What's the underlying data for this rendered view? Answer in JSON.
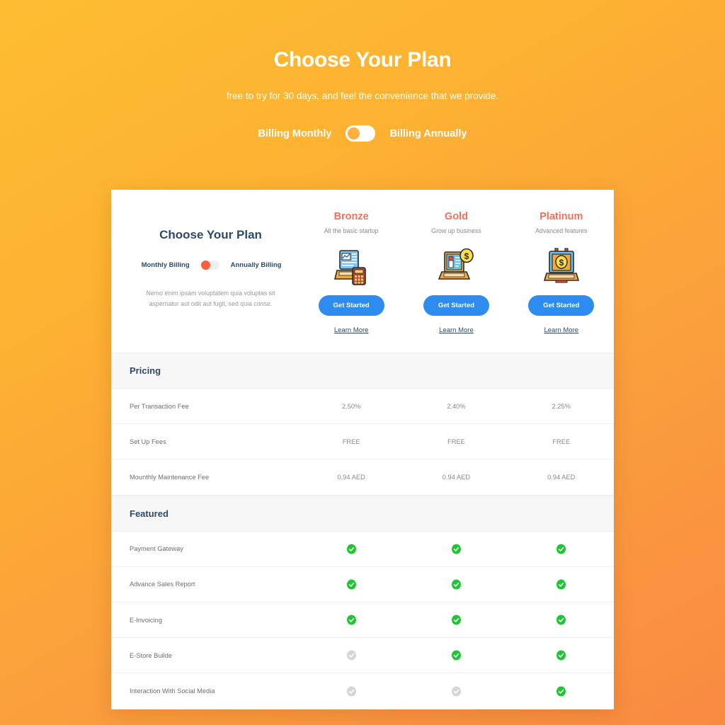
{
  "hero": {
    "title": "Choose Your Plan",
    "subtitle": "free to try for 30 days, and feel the convenience that we provide.",
    "billing_monthly_label": "Billing Monthly",
    "billing_annually_label": "Billing Annually",
    "toggle_state": "monthly"
  },
  "card": {
    "intro": {
      "title": "Choose Your Plan",
      "monthly_label": "Monthly Billing",
      "annually_label": "Annually Billing",
      "toggle_state": "monthly",
      "description_line1": "Nemo enim ipsam voluptatem quia voluptas sit",
      "description_line2": "aspernatur aut odit aut fugit, sed quia conse."
    },
    "plans": [
      {
        "name": "Bronze",
        "subtitle": "All the basic  startup",
        "art": "chart-document-calculator-icon",
        "cta_label": "Get Started",
        "link_label": "Learn More"
      },
      {
        "name": "Gold",
        "subtitle": "Grow up  business",
        "art": "laptop-coin-icon",
        "cta_label": "Get Started",
        "link_label": "Learn More"
      },
      {
        "name": "Platinum",
        "subtitle": "Advanced features",
        "art": "clipboard-dollar-coin-icon",
        "cta_label": "Get Started",
        "link_label": "Learn More"
      }
    ],
    "sections": [
      {
        "title": "Pricing",
        "rows": [
          {
            "label": "Per Transaction Fee",
            "values": [
              "2.50%",
              "2.40%",
              "2.25%"
            ],
            "type": "text"
          },
          {
            "label": "Set Up Fees",
            "values": [
              "FREE",
              "FREE",
              "FREE"
            ],
            "type": "text"
          },
          {
            "label": "Mounthly Maintenance Fee",
            "values": [
              "0.94 AED",
              "0.94 AED",
              "0.94 AED"
            ],
            "type": "text"
          }
        ]
      },
      {
        "title": "Featured",
        "rows": [
          {
            "label": "Payment Gateway",
            "values": [
              "on",
              "on",
              "on"
            ],
            "type": "check"
          },
          {
            "label": "Advance Sales Report",
            "values": [
              "on",
              "on",
              "on"
            ],
            "type": "check"
          },
          {
            "label": "E-Invoicing",
            "values": [
              "on",
              "on",
              "on"
            ],
            "type": "check"
          },
          {
            "label": "E-Store Builde",
            "values": [
              "off",
              "on",
              "on"
            ],
            "type": "check"
          },
          {
            "label": "Interaction With Social Media",
            "values": [
              "off",
              "off",
              "on"
            ],
            "type": "check"
          }
        ]
      }
    ]
  },
  "colors": {
    "background_top": "#FDBD33",
    "background_bottom": "#F98A42",
    "plan_name": "#F4705A",
    "heading_navy": "#2D4A6B",
    "cta_blue": "#2E8BF0",
    "check_on": "#21C435",
    "check_off": "#D5D5D5",
    "toggle_knob": "#F4613E"
  }
}
